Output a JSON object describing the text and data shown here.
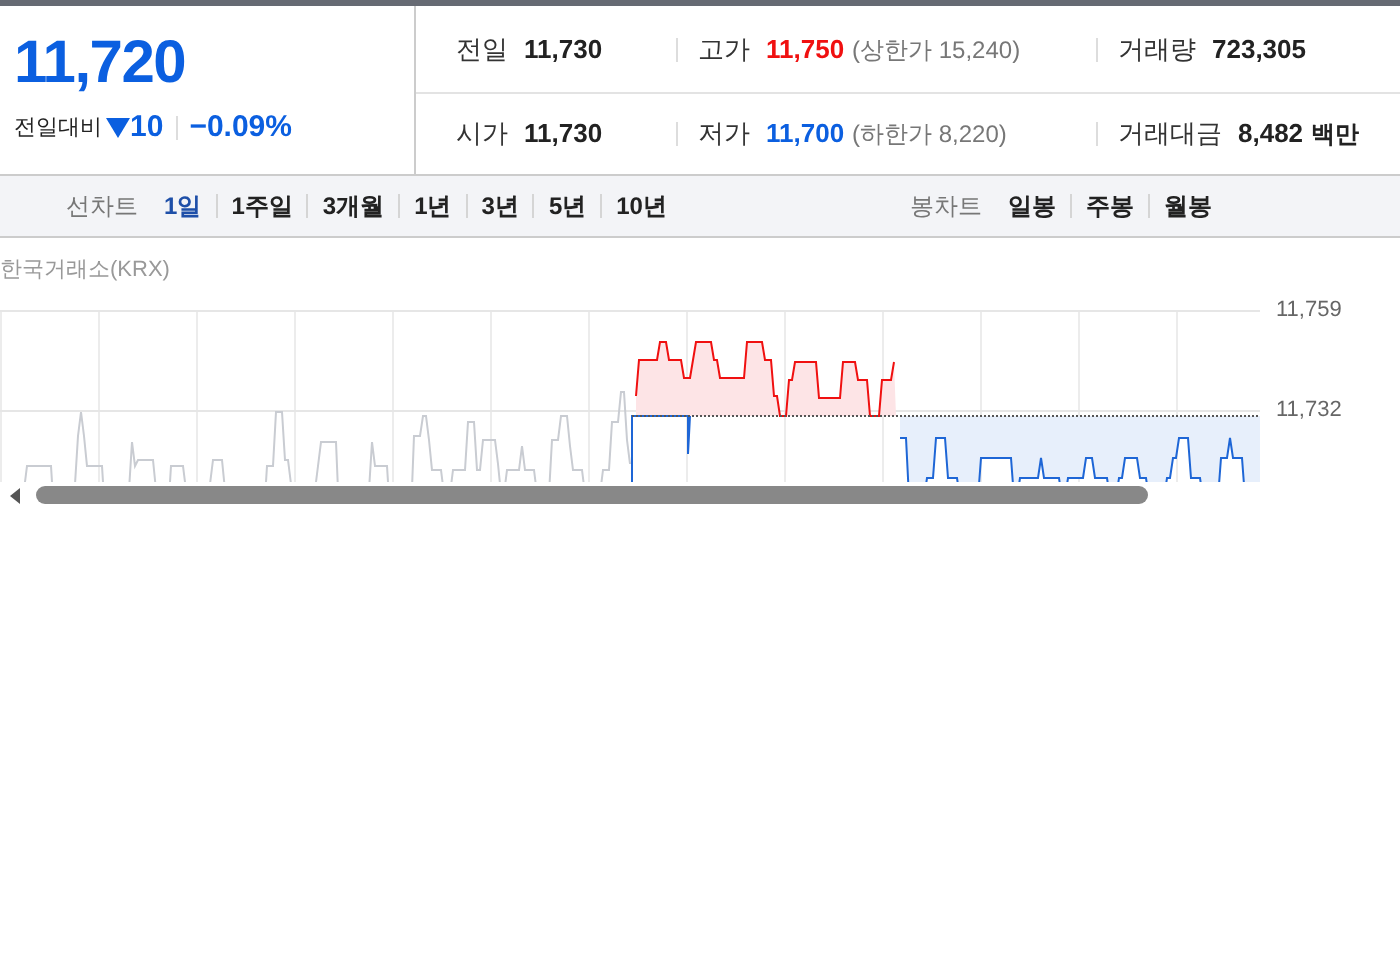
{
  "quote": {
    "price": "11,720",
    "change_label": "전일대비",
    "down": true,
    "change": "10",
    "change_rate": "−0.09%"
  },
  "stats": [
    {
      "label": "전일",
      "value": "11,730",
      "color": "#222222"
    },
    {
      "label": "고가",
      "value": "11,750",
      "color": "#f01010",
      "note": "(상한가 15,240)"
    },
    {
      "label": "거래량",
      "value": "723,305",
      "color": "#222222"
    },
    {
      "label": "시가",
      "value": "11,730",
      "color": "#222222"
    },
    {
      "label": "저가",
      "value": "11,700",
      "color": "#0b5fe0",
      "note": "(하한가 8,220)"
    },
    {
      "label": "거래대금",
      "value": "8,482",
      "color": "#222222",
      "unit": "백만"
    }
  ],
  "line_chart": {
    "label": "선차트",
    "options": [
      {
        "label": "1일",
        "selected": true
      },
      {
        "label": "1주일",
        "selected": false
      },
      {
        "label": "3개월",
        "selected": false
      },
      {
        "label": "1년",
        "selected": false
      },
      {
        "label": "3년",
        "selected": false
      },
      {
        "label": "5년",
        "selected": false
      },
      {
        "label": "10년",
        "selected": false
      }
    ]
  },
  "candle_chart": {
    "label": "봉차트",
    "options": [
      {
        "label": "일봉",
        "selected": false
      },
      {
        "label": "주봉",
        "selected": false
      },
      {
        "label": "월봉",
        "selected": false
      }
    ]
  },
  "chart": {
    "source": "한국거래소(KRX)",
    "y_labels": [
      "11,759",
      "11,732"
    ]
  }
}
